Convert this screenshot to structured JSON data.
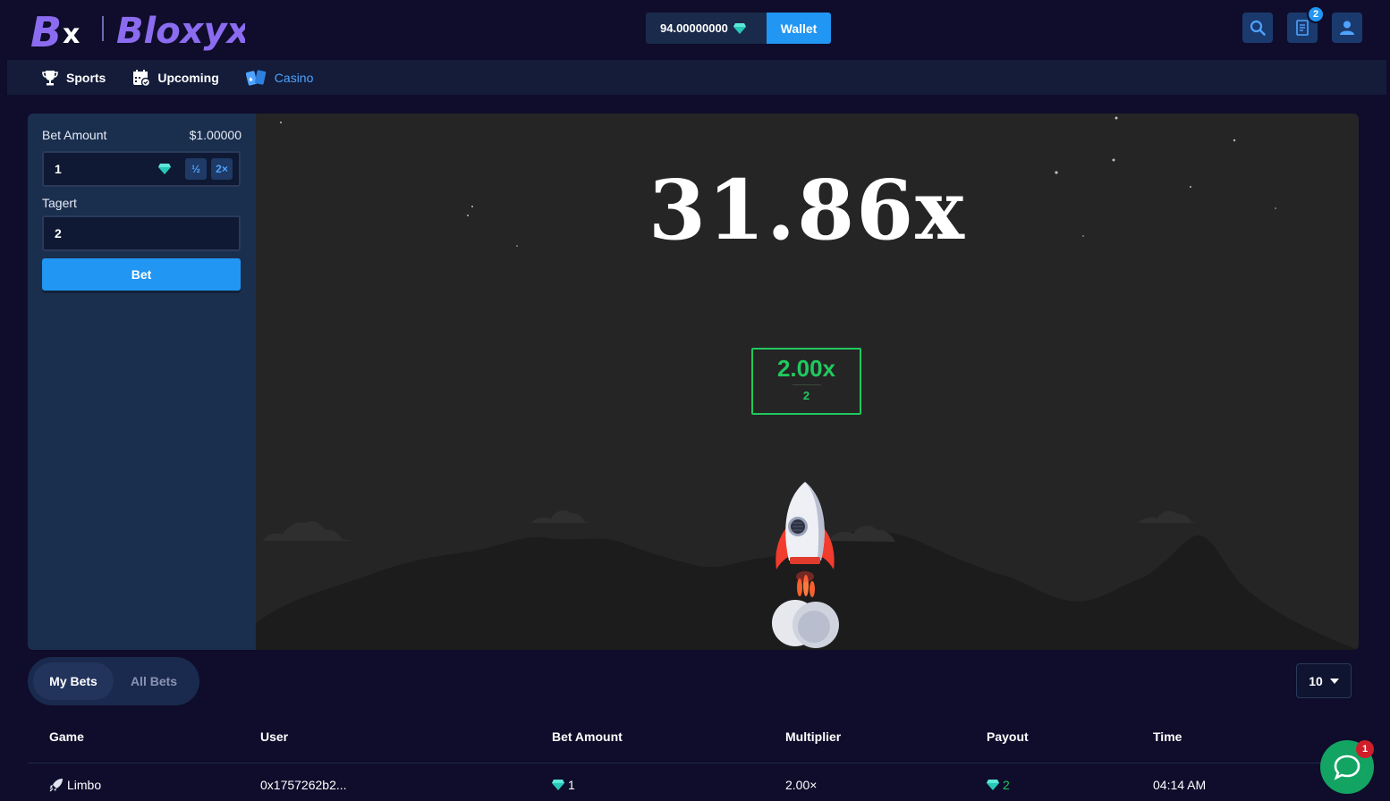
{
  "header": {
    "logo_text": "Bloxyx",
    "balance": "94.00000000",
    "wallet_label": "Wallet",
    "notification_count": "2"
  },
  "nav": {
    "items": [
      {
        "label": "Sports",
        "icon": "trophy-icon"
      },
      {
        "label": "Upcoming",
        "icon": "calendar-icon"
      },
      {
        "label": "Casino",
        "icon": "cards-icon",
        "active": true
      }
    ]
  },
  "bet_panel": {
    "bet_amount_label": "Bet Amount",
    "bet_amount_usd": "$1.00000",
    "bet_amount_value": "1",
    "half_label": "½",
    "double_label": "2×",
    "target_label": "Tagert",
    "target_value": "2",
    "bet_button": "Bet"
  },
  "game": {
    "result_multiplier": "31.86x",
    "target_multiplier": "2.00x",
    "target_value": "2"
  },
  "tabs": {
    "my_bets": "My Bets",
    "all_bets": "All Bets",
    "per_page": "10"
  },
  "table": {
    "headers": {
      "game": "Game",
      "user": "User",
      "bet_amount": "Bet Amount",
      "multiplier": "Multiplier",
      "payout": "Payout",
      "time": "Time"
    },
    "rows": [
      {
        "game": "Limbo",
        "user": "0x1757262b2...",
        "bet_amount": "1",
        "multiplier": "2.00×",
        "payout": "2",
        "time": "04:14 AM"
      }
    ]
  },
  "chat": {
    "badge": "1"
  },
  "colors": {
    "accent": "#2196f3",
    "win_green": "#20c95e",
    "gem_teal": "#27c8b8"
  }
}
